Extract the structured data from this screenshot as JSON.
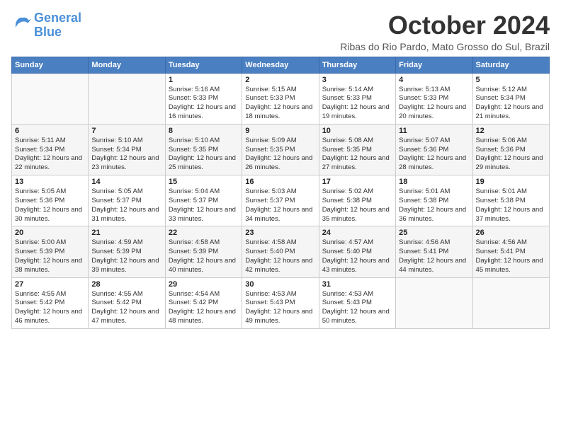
{
  "logo": {
    "line1": "General",
    "line2": "Blue"
  },
  "title": "October 2024",
  "location": "Ribas do Rio Pardo, Mato Grosso do Sul, Brazil",
  "weekdays": [
    "Sunday",
    "Monday",
    "Tuesday",
    "Wednesday",
    "Thursday",
    "Friday",
    "Saturday"
  ],
  "weeks": [
    [
      {
        "day": "",
        "info": ""
      },
      {
        "day": "",
        "info": ""
      },
      {
        "day": "1",
        "info": "Sunrise: 5:16 AM\nSunset: 5:33 PM\nDaylight: 12 hours and 16 minutes."
      },
      {
        "day": "2",
        "info": "Sunrise: 5:15 AM\nSunset: 5:33 PM\nDaylight: 12 hours and 18 minutes."
      },
      {
        "day": "3",
        "info": "Sunrise: 5:14 AM\nSunset: 5:33 PM\nDaylight: 12 hours and 19 minutes."
      },
      {
        "day": "4",
        "info": "Sunrise: 5:13 AM\nSunset: 5:33 PM\nDaylight: 12 hours and 20 minutes."
      },
      {
        "day": "5",
        "info": "Sunrise: 5:12 AM\nSunset: 5:34 PM\nDaylight: 12 hours and 21 minutes."
      }
    ],
    [
      {
        "day": "6",
        "info": "Sunrise: 5:11 AM\nSunset: 5:34 PM\nDaylight: 12 hours and 22 minutes."
      },
      {
        "day": "7",
        "info": "Sunrise: 5:10 AM\nSunset: 5:34 PM\nDaylight: 12 hours and 23 minutes."
      },
      {
        "day": "8",
        "info": "Sunrise: 5:10 AM\nSunset: 5:35 PM\nDaylight: 12 hours and 25 minutes."
      },
      {
        "day": "9",
        "info": "Sunrise: 5:09 AM\nSunset: 5:35 PM\nDaylight: 12 hours and 26 minutes."
      },
      {
        "day": "10",
        "info": "Sunrise: 5:08 AM\nSunset: 5:35 PM\nDaylight: 12 hours and 27 minutes."
      },
      {
        "day": "11",
        "info": "Sunrise: 5:07 AM\nSunset: 5:36 PM\nDaylight: 12 hours and 28 minutes."
      },
      {
        "day": "12",
        "info": "Sunrise: 5:06 AM\nSunset: 5:36 PM\nDaylight: 12 hours and 29 minutes."
      }
    ],
    [
      {
        "day": "13",
        "info": "Sunrise: 5:05 AM\nSunset: 5:36 PM\nDaylight: 12 hours and 30 minutes."
      },
      {
        "day": "14",
        "info": "Sunrise: 5:05 AM\nSunset: 5:37 PM\nDaylight: 12 hours and 31 minutes."
      },
      {
        "day": "15",
        "info": "Sunrise: 5:04 AM\nSunset: 5:37 PM\nDaylight: 12 hours and 33 minutes."
      },
      {
        "day": "16",
        "info": "Sunrise: 5:03 AM\nSunset: 5:37 PM\nDaylight: 12 hours and 34 minutes."
      },
      {
        "day": "17",
        "info": "Sunrise: 5:02 AM\nSunset: 5:38 PM\nDaylight: 12 hours and 35 minutes."
      },
      {
        "day": "18",
        "info": "Sunrise: 5:01 AM\nSunset: 5:38 PM\nDaylight: 12 hours and 36 minutes."
      },
      {
        "day": "19",
        "info": "Sunrise: 5:01 AM\nSunset: 5:38 PM\nDaylight: 12 hours and 37 minutes."
      }
    ],
    [
      {
        "day": "20",
        "info": "Sunrise: 5:00 AM\nSunset: 5:39 PM\nDaylight: 12 hours and 38 minutes."
      },
      {
        "day": "21",
        "info": "Sunrise: 4:59 AM\nSunset: 5:39 PM\nDaylight: 12 hours and 39 minutes."
      },
      {
        "day": "22",
        "info": "Sunrise: 4:58 AM\nSunset: 5:39 PM\nDaylight: 12 hours and 40 minutes."
      },
      {
        "day": "23",
        "info": "Sunrise: 4:58 AM\nSunset: 5:40 PM\nDaylight: 12 hours and 42 minutes."
      },
      {
        "day": "24",
        "info": "Sunrise: 4:57 AM\nSunset: 5:40 PM\nDaylight: 12 hours and 43 minutes."
      },
      {
        "day": "25",
        "info": "Sunrise: 4:56 AM\nSunset: 5:41 PM\nDaylight: 12 hours and 44 minutes."
      },
      {
        "day": "26",
        "info": "Sunrise: 4:56 AM\nSunset: 5:41 PM\nDaylight: 12 hours and 45 minutes."
      }
    ],
    [
      {
        "day": "27",
        "info": "Sunrise: 4:55 AM\nSunset: 5:42 PM\nDaylight: 12 hours and 46 minutes."
      },
      {
        "day": "28",
        "info": "Sunrise: 4:55 AM\nSunset: 5:42 PM\nDaylight: 12 hours and 47 minutes."
      },
      {
        "day": "29",
        "info": "Sunrise: 4:54 AM\nSunset: 5:42 PM\nDaylight: 12 hours and 48 minutes."
      },
      {
        "day": "30",
        "info": "Sunrise: 4:53 AM\nSunset: 5:43 PM\nDaylight: 12 hours and 49 minutes."
      },
      {
        "day": "31",
        "info": "Sunrise: 4:53 AM\nSunset: 5:43 PM\nDaylight: 12 hours and 50 minutes."
      },
      {
        "day": "",
        "info": ""
      },
      {
        "day": "",
        "info": ""
      }
    ]
  ]
}
